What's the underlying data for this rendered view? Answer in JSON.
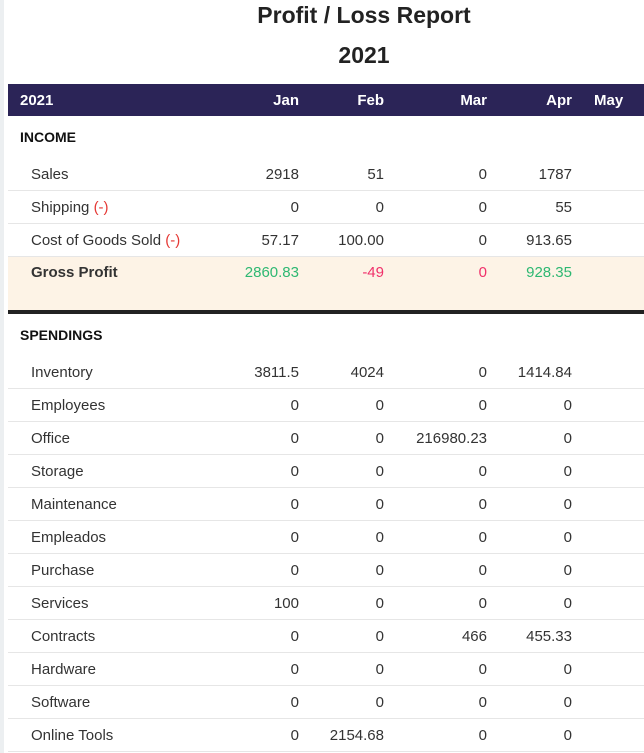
{
  "title": "Profit / Loss Report",
  "year": "2021",
  "columns": [
    "2021",
    "Jan",
    "Feb",
    "Mar",
    "Apr",
    "May"
  ],
  "minus_marker": "(-)",
  "income": {
    "label": "INCOME",
    "rows": [
      {
        "label": "Sales",
        "minus": false,
        "values": [
          "2918",
          "51",
          "0",
          "1787",
          ""
        ]
      },
      {
        "label": "Shipping",
        "minus": true,
        "values": [
          "0",
          "0",
          "0",
          "55",
          ""
        ]
      },
      {
        "label": "Cost of Goods Sold",
        "minus": true,
        "values": [
          "57.17",
          "100.00",
          "0",
          "913.65",
          ""
        ]
      }
    ]
  },
  "gross_profit": {
    "label": "Gross Profit",
    "values": [
      "2860.83",
      "-49",
      "0",
      "928.35",
      ""
    ]
  },
  "colors": {
    "header": "#2b2457",
    "positive": "#2eb872",
    "negative": "#f0306a"
  },
  "spendings": {
    "label": "SPENDINGS",
    "rows": [
      {
        "label": "Inventory",
        "values": [
          "3811.5",
          "4024",
          "0",
          "1414.84",
          ""
        ]
      },
      {
        "label": "Employees",
        "values": [
          "0",
          "0",
          "0",
          "0",
          ""
        ]
      },
      {
        "label": "Office",
        "values": [
          "0",
          "0",
          "216980.23",
          "0",
          ""
        ]
      },
      {
        "label": "Storage",
        "values": [
          "0",
          "0",
          "0",
          "0",
          ""
        ]
      },
      {
        "label": "Maintenance",
        "values": [
          "0",
          "0",
          "0",
          "0",
          ""
        ]
      },
      {
        "label": "Empleados",
        "values": [
          "0",
          "0",
          "0",
          "0",
          ""
        ]
      },
      {
        "label": "Purchase",
        "values": [
          "0",
          "0",
          "0",
          "0",
          ""
        ]
      },
      {
        "label": "Services",
        "values": [
          "100",
          "0",
          "0",
          "0",
          ""
        ]
      },
      {
        "label": "Contracts",
        "values": [
          "0",
          "0",
          "466",
          "455.33",
          ""
        ]
      },
      {
        "label": "Hardware",
        "values": [
          "0",
          "0",
          "0",
          "0",
          ""
        ]
      },
      {
        "label": "Software",
        "values": [
          "0",
          "0",
          "0",
          "0",
          ""
        ]
      },
      {
        "label": "Online Tools",
        "values": [
          "0",
          "2154.68",
          "0",
          "0",
          ""
        ]
      }
    ]
  }
}
